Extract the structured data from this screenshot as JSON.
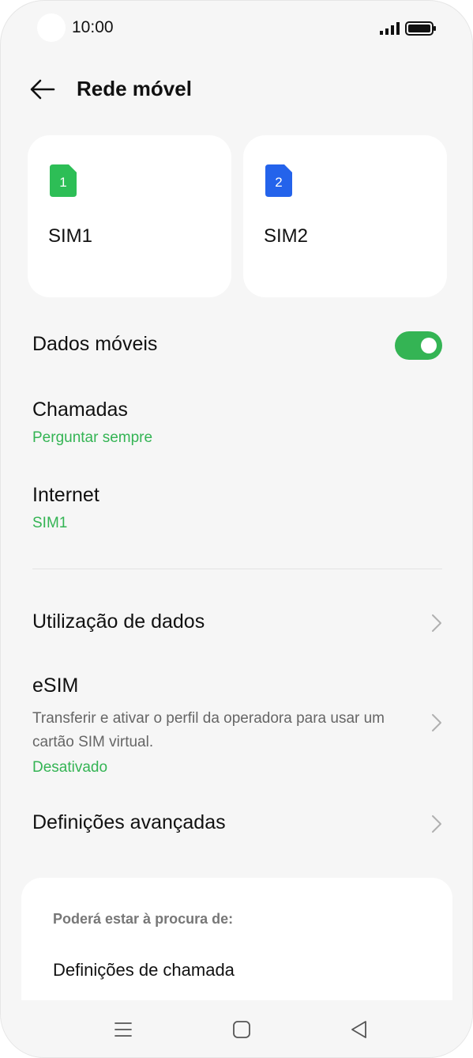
{
  "status_bar": {
    "time": "10:00"
  },
  "header": {
    "title": "Rede móvel"
  },
  "sim_cards": [
    {
      "number": "1",
      "label": "SIM1",
      "color": "#2dbe56"
    },
    {
      "number": "2",
      "label": "SIM2",
      "color": "#2463eb"
    }
  ],
  "mobile_data": {
    "label": "Dados móveis",
    "enabled": true
  },
  "calls": {
    "label": "Chamadas",
    "value": "Perguntar sempre"
  },
  "internet": {
    "label": "Internet",
    "value": "SIM1"
  },
  "data_usage": {
    "label": "Utilização de dados"
  },
  "esim": {
    "label": "eSIM",
    "description": "Transferir e ativar o perfil da operadora para usar um cartão SIM virtual.",
    "status": "Desativado"
  },
  "advanced": {
    "label": "Definições avançadas"
  },
  "suggestions": {
    "heading": "Poderá estar à procura de:",
    "items": [
      "Definições de chamada"
    ]
  },
  "colors": {
    "accent": "#34b454",
    "background": "#f6f6f6",
    "card": "#ffffff"
  },
  "icons": {
    "back": "arrow-left-icon",
    "chevron": "chevron-right-icon",
    "signal": "signal-icon",
    "battery": "battery-icon",
    "nav_menu": "menu-icon",
    "nav_home": "home-icon",
    "nav_back": "back-triangle-icon"
  }
}
